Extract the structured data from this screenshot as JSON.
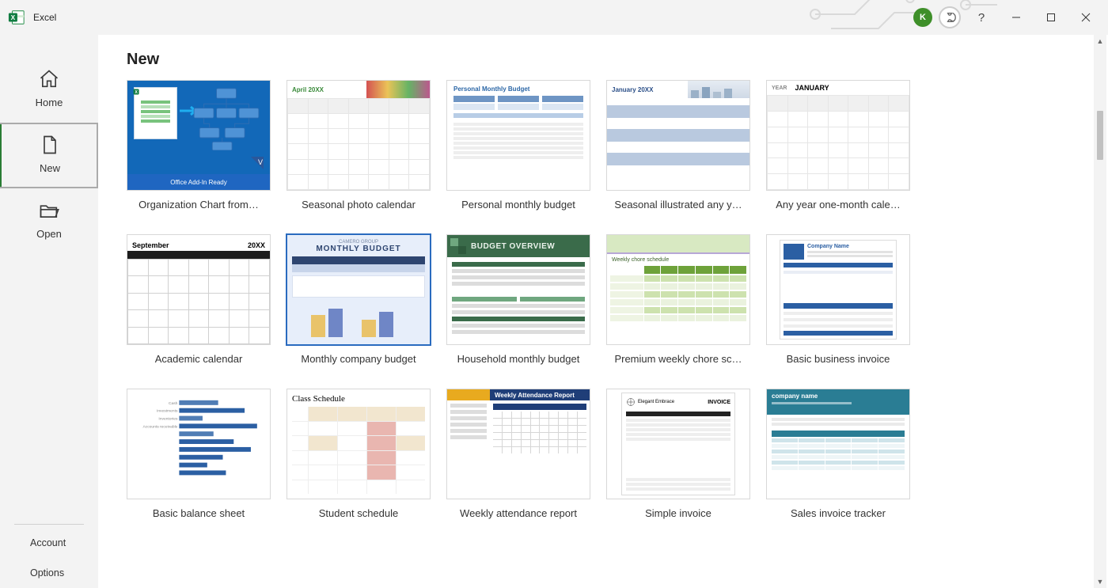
{
  "app": {
    "title": "Excel"
  },
  "account": {
    "initial": "K"
  },
  "sidebar": {
    "home": "Home",
    "new": "New",
    "open": "Open",
    "account": "Account",
    "options": "Options"
  },
  "page": {
    "title": "New"
  },
  "templates": [
    {
      "id": "org-chart",
      "label": "Organization Chart from…",
      "footer": "Office Add-In Ready"
    },
    {
      "id": "seasonal-photo-calendar",
      "label": "Seasonal photo calendar",
      "month": "April 20XX"
    },
    {
      "id": "personal-monthly-budget",
      "label": "Personal monthly budget",
      "title_in": "Personal Monthly Budget"
    },
    {
      "id": "seasonal-illustrated-any-year",
      "label": "Seasonal illustrated any y…",
      "month": "January 20XX"
    },
    {
      "id": "any-year-one-month",
      "label": "Any year one-month cale…",
      "year_label": "YEAR",
      "month_label": "JANUARY"
    },
    {
      "id": "academic-calendar",
      "label": "Academic calendar",
      "month": "September",
      "year": "20XX"
    },
    {
      "id": "monthly-company-budget",
      "label": "Monthly company budget",
      "title_in": "MONTHLY BUDGET",
      "subtitle_in": "CAMERO GROUP"
    },
    {
      "id": "household-monthly-budget",
      "label": "Household monthly budget",
      "title_in": "BUDGET OVERVIEW"
    },
    {
      "id": "premium-weekly-chore",
      "label": "Premium weekly chore sc…",
      "title_in": "Weekly chore schedule"
    },
    {
      "id": "basic-business-invoice",
      "label": "Basic business invoice",
      "company": "Company Name"
    },
    {
      "id": "basic-balance-sheet",
      "label": "Basic balance sheet"
    },
    {
      "id": "student-schedule",
      "label": "Student schedule",
      "title_in": "Class Schedule"
    },
    {
      "id": "weekly-attendance",
      "label": "Weekly attendance report",
      "title_in": "Weekly Attendance Report"
    },
    {
      "id": "simple-invoice",
      "label": "Simple invoice",
      "brand": "Elegant Embrace",
      "invoice": "INVOICE"
    },
    {
      "id": "sales-invoice-tracker",
      "label": "Sales invoice tracker",
      "brand": "company name"
    }
  ]
}
